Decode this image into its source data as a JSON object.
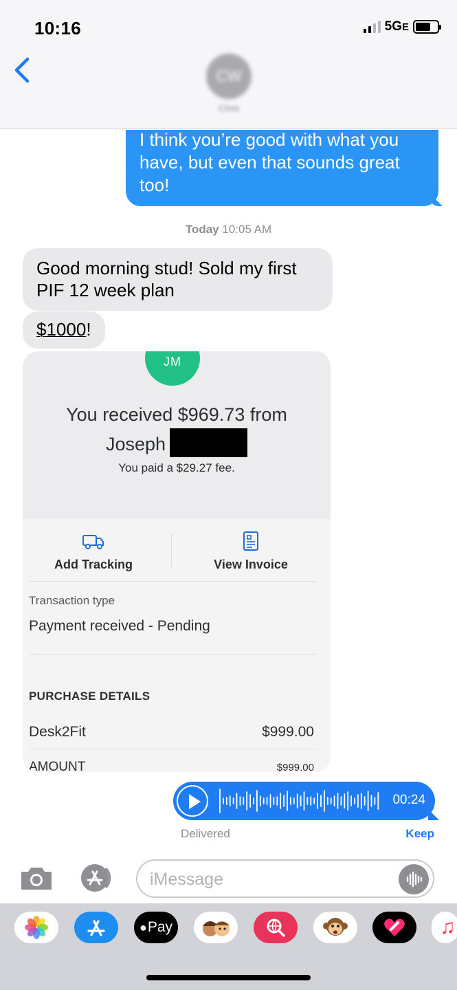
{
  "status_bar": {
    "time": "10:16",
    "network": "5G",
    "network_suffix": "E"
  },
  "header": {
    "avatar_initials": "CW",
    "contact_name": "Chris"
  },
  "messages": {
    "outgoing_1": "I think you’re good with what you have, but even that sounds great too!",
    "timestamp_day": "Today",
    "timestamp_time": "10:05 AM",
    "incoming_1": "Good morning stud! Sold my first PIF 12 week plan",
    "incoming_2_link": "$1000",
    "incoming_2_suffix": "!"
  },
  "payment_card": {
    "initials": "JM",
    "received_line1": "You received $969.73 from",
    "received_name": "Joseph",
    "fee_text": "You paid a $29.27 fee.",
    "action_1": "Add Tracking",
    "action_2": "View Invoice",
    "transaction_type_label": "Transaction type",
    "transaction_type_value": "Payment received - Pending",
    "purchase_details_title": "PURCHASE DETAILS",
    "item_name": "Desk2Fit",
    "item_amount": "$999.00",
    "amount_label": "AMOUNT",
    "amount_value": "$999.00"
  },
  "audio_message": {
    "duration": "00:24",
    "status": "Delivered",
    "keep_label": "Keep"
  },
  "input": {
    "placeholder": "iMessage"
  },
  "app_drawer": {
    "apps": [
      "photos-icon",
      "app-store-icon",
      "apple-pay-icon",
      "memoji-icon",
      "web-search-icon",
      "animoji-icon",
      "digital-touch-icon",
      "music-icon"
    ],
    "apple_pay_label": "Pay"
  },
  "colors": {
    "imessage_blue": "#2b95f6",
    "incoming_gray": "#e9e9eb",
    "venmo_green": "#21c187"
  }
}
